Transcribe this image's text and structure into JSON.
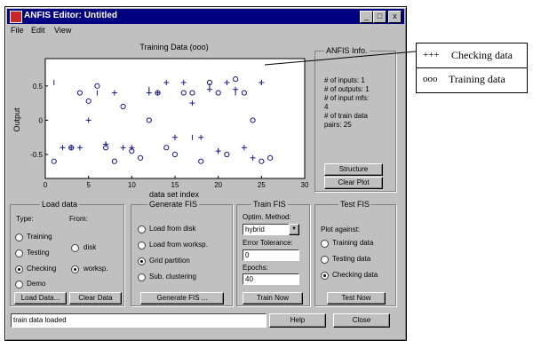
{
  "window": {
    "title": "ANFIS Editor: Untitled",
    "buttons": {
      "minimize": "_",
      "maximize": "□",
      "close": "x"
    }
  },
  "menu": [
    "File",
    "Edit",
    "View"
  ],
  "chart_data": {
    "type": "scatter",
    "title": "Training Data (ooo)",
    "xlabel": "data set index",
    "ylabel": "Output",
    "xlim": [
      0,
      30
    ],
    "ylim": [
      -0.85,
      0.9
    ],
    "xticks": [
      "0",
      "5",
      "10",
      "15",
      "20",
      "25",
      "30"
    ],
    "yticks": [
      "0.5",
      "0",
      "-0.5"
    ],
    "series": [
      {
        "name": "Training data",
        "marker": "o",
        "x": [
          1,
          3,
          4,
          5,
          6,
          7,
          8,
          9,
          10,
          11,
          12,
          13,
          14,
          15,
          16,
          17,
          18,
          19,
          20,
          21,
          22,
          23,
          24,
          25,
          26
        ],
        "y": [
          -0.6,
          -0.4,
          0.4,
          0.28,
          0.5,
          -0.4,
          -0.6,
          0.2,
          -0.45,
          -0.55,
          0.0,
          0.4,
          -0.4,
          -0.5,
          0.4,
          0.4,
          -0.6,
          0.55,
          0.4,
          -0.5,
          0.6,
          0.4,
          0.0,
          -0.6,
          -0.55
        ]
      },
      {
        "name": "Checking data",
        "marker": "+",
        "x": [
          2,
          3,
          4,
          5,
          7,
          8,
          9,
          10,
          12,
          13,
          14,
          15,
          16,
          17,
          18,
          19,
          20,
          21,
          22,
          23,
          24,
          25
        ],
        "y": [
          -0.4,
          -0.4,
          -0.4,
          0.0,
          -0.35,
          0.4,
          -0.4,
          -0.4,
          0.4,
          0.4,
          0.55,
          -0.25,
          0.55,
          0.25,
          -0.25,
          0.45,
          -0.45,
          0.55,
          0.45,
          -0.4,
          -0.55,
          0.55
        ]
      },
      {
        "name": "",
        "marker": "|",
        "x": [
          1,
          6,
          7,
          12,
          15,
          17,
          19,
          20,
          22,
          25
        ],
        "y": [
          0.55,
          0.4,
          -0.35,
          0.45,
          -0.25,
          -0.25,
          0.5,
          -0.45,
          0.4,
          0.55
        ]
      }
    ]
  },
  "callout": {
    "checking_prefix": "+++",
    "checking_label": "Checking data",
    "training_prefix": "ooo",
    "training_label": "Training data"
  },
  "anfis_info": {
    "title": "ANFIS Info.",
    "lines": [
      "# of inputs: 1",
      "# of outputs: 1",
      "# of input mfs:",
      "4",
      "# of train data",
      "pairs: 25"
    ],
    "structure_button": "Structure",
    "clear_plot_button": "Clear Plot"
  },
  "load_data": {
    "title": "Load data",
    "type_label": "Type:",
    "from_label": "From:",
    "type_options": [
      "Training",
      "Testing",
      "Checking",
      "Demo"
    ],
    "type_selected": "Checking",
    "from_options": [
      "disk",
      "worksp."
    ],
    "from_selected": "worksp.",
    "load_button": "Load Data...",
    "clear_button": "Clear Data"
  },
  "generate_fis": {
    "title": "Generate FIS",
    "options": [
      "Load from disk",
      "Load from worksp.",
      "Grid partition",
      "Sub. clustering"
    ],
    "selected": "Grid partition",
    "button": "Generate FIS ..."
  },
  "train_fis": {
    "title": "Train FIS",
    "optim_label": "Optim. Method:",
    "optim_value": "hybrid",
    "tolerance_label": "Error Tolerance:",
    "tolerance_value": "0",
    "epochs_label": "Epochs:",
    "epochs_value": "40",
    "button": "Train Now"
  },
  "test_fis": {
    "title": "Test FIS",
    "plot_against": "Plot against:",
    "options": [
      "Training data",
      "Testing data",
      "Checking data"
    ],
    "selected": "Checking data",
    "button": "Test Now"
  },
  "status": {
    "text": "train data loaded",
    "help_button": "Help",
    "close_button": "Close"
  }
}
